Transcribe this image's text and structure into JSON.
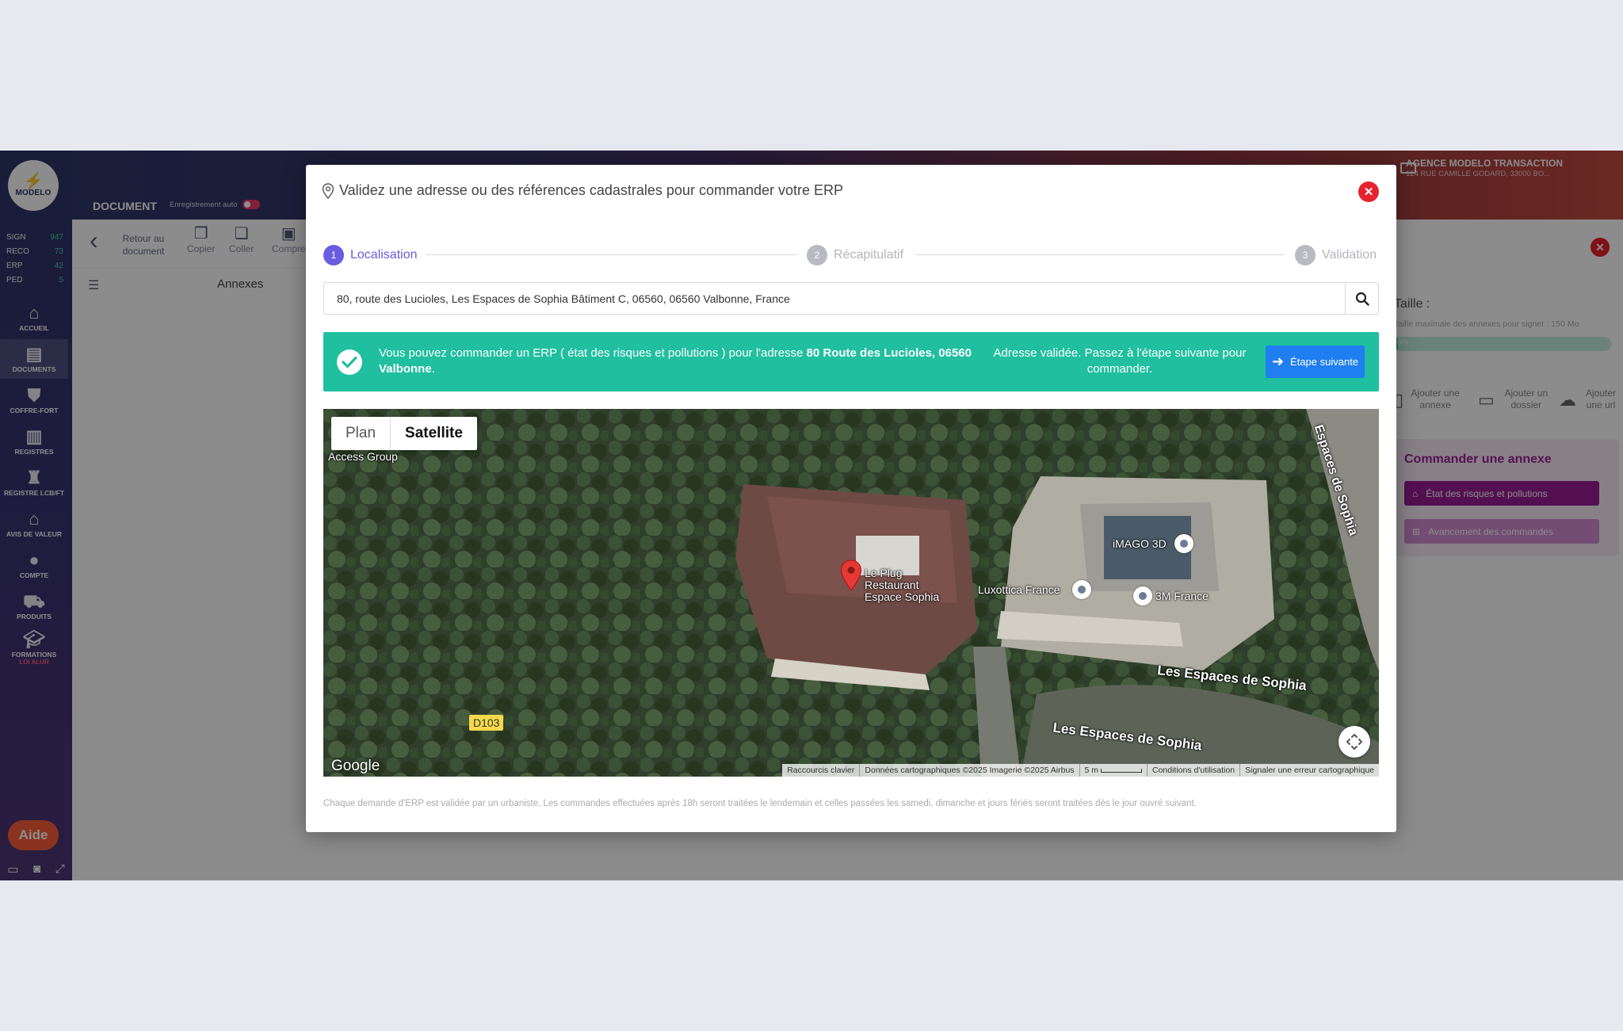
{
  "sidebar": {
    "logo_text": "MODELO",
    "stats": [
      {
        "label": "SIGN",
        "value": "947"
      },
      {
        "label": "RECO",
        "value": "73"
      },
      {
        "label": "ERP",
        "value": "42"
      },
      {
        "label": "PED",
        "value": "5"
      }
    ],
    "items": [
      {
        "label": "ACCUEIL",
        "icon": "home-icon"
      },
      {
        "label": "DOCUMENTS",
        "icon": "documents-icon"
      },
      {
        "label": "COFFRE-FORT",
        "icon": "shield-icon"
      },
      {
        "label": "REGISTRES",
        "icon": "registers-icon"
      },
      {
        "label": "REGISTRE LCB/FT",
        "icon": "registre-lcb-icon"
      },
      {
        "label": "AVIS DE VALEUR",
        "icon": "house-value-icon"
      },
      {
        "label": "COMPTE",
        "icon": "user-icon"
      },
      {
        "label": "PRODUITS",
        "icon": "cart-icon"
      },
      {
        "label": "FORMATIONS",
        "sub": "LOI ALUR",
        "icon": "graduation-cap-icon"
      }
    ],
    "help_label": "Aide"
  },
  "topbar": {
    "doc_title": "DOCUMENT",
    "autosave_label": "Enregistrement auto",
    "agency_name": "AGENCE MODELO TRANSACTION",
    "agency_address": "124 RUE CAMILLE GODARD, 33000 BO..."
  },
  "toolbar": {
    "back_label": "Retour au document",
    "copy_label": "Copier",
    "paste_label": "Coller",
    "compress_label": "Compre"
  },
  "annexes_label": "Annexes",
  "right_panel": {
    "size_label": "Taille :",
    "size_sub": "Taille maximale des annexes pour signer : 150 Mo",
    "progress_pct": "0%",
    "progress_value": 0.02,
    "add_annex": "Ajouter une annexe",
    "add_folder": "Ajouter un dossier",
    "add_url": "Ajouter une url",
    "order_title": "Commander une annexe",
    "order_erp": "État des risques et pollutions",
    "order_progress": "Avancement des commandes"
  },
  "modal": {
    "title": "Validez une adresse ou des références cadastrales pour commander votre ERP",
    "steps": [
      {
        "num": "1",
        "label": "Localisation",
        "state": "active"
      },
      {
        "num": "2",
        "label": "Récapitulatif",
        "state": "inactive"
      },
      {
        "num": "3",
        "label": "Validation",
        "state": "inactive"
      }
    ],
    "search_value": "80, route des Lucioles, Les Espaces de Sophia Bâtiment C, 06560, 06560 Valbonne, France",
    "banner": {
      "text_before": "Vous pouvez commander un ERP ( état des risques et pollutions ) pour l'adresse ",
      "text_bold": "80 Route des Lucioles, 06560 Valbonne",
      "text_after": ".",
      "status_text": "Adresse validée. Passez à l'étape suivante pour commander.",
      "next_label": "Étape suivante"
    },
    "map": {
      "tab_plan": "Plan",
      "tab_satellite": "Satellite",
      "labels": {
        "access_group": "Access Group",
        "restaurant": "Le Plug Restaurant Espace Sophia",
        "imago": "iMAGO 3D",
        "luxottica": "Luxottica France",
        "three_m": "3M France",
        "espaces_1": "Les Espaces de Sophia",
        "espaces_2": "Les Espaces de Sophia",
        "espaces_vertical": "Espaces de Sophia",
        "road": "D103",
        "brand": "Google"
      },
      "attribution": {
        "shortcuts": "Raccourcis clavier",
        "data": "Données cartographiques ©2025 Imagerie ©2025 Airbus",
        "scale": "5 m",
        "terms": "Conditions d'utilisation",
        "report": "Signaler une erreur cartographique"
      }
    },
    "footnote": "Chaque demande d'ERP est validée par un urbaniste. Les commandes effectuées après 18h seront traitées le lendemain et celles passées les samedi, dimanche et jours fériés seront traitées dès le jour ouvré suivant."
  },
  "colors": {
    "accent": "#6a5ce0",
    "success": "#1fbf9f",
    "primary_button": "#1f7ff0",
    "close": "#e6232c",
    "order_purple": "#9a1d94"
  }
}
